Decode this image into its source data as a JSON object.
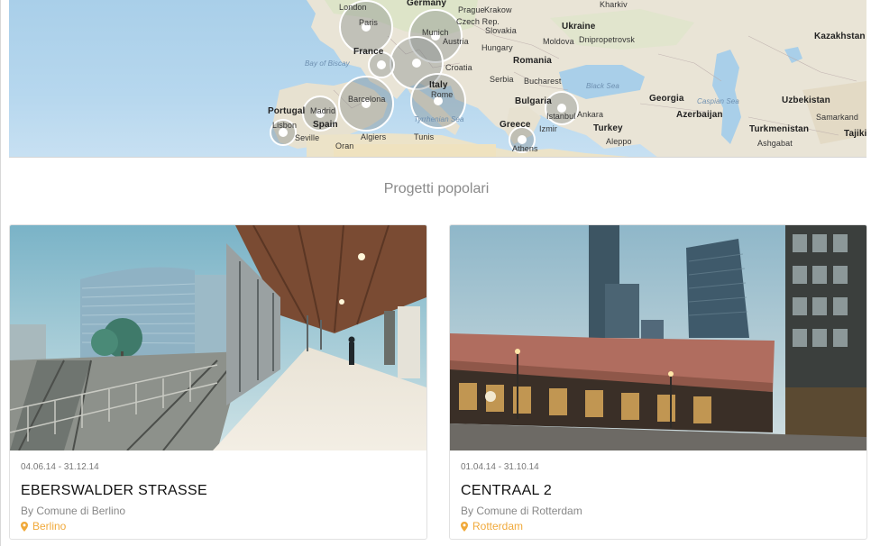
{
  "map": {
    "labels": [
      {
        "text": "London",
        "kind": "normal"
      },
      {
        "text": "Germany",
        "kind": "big"
      },
      {
        "text": "Prague",
        "kind": "normal"
      },
      {
        "text": "Krakow",
        "kind": "normal"
      },
      {
        "text": "Paris",
        "kind": "normal"
      },
      {
        "text": "Czech Rep.",
        "kind": "normal"
      },
      {
        "text": "Slovakia",
        "kind": "normal"
      },
      {
        "text": "Munich",
        "kind": "normal"
      },
      {
        "text": "Austria",
        "kind": "normal"
      },
      {
        "text": "Hungary",
        "kind": "normal"
      },
      {
        "text": "France",
        "kind": "big"
      },
      {
        "text": "Croatia",
        "kind": "normal"
      },
      {
        "text": "Romania",
        "kind": "big"
      },
      {
        "text": "Bay of Biscay",
        "kind": "sea"
      },
      {
        "text": "Serbia",
        "kind": "normal"
      },
      {
        "text": "Bucharest",
        "kind": "normal"
      },
      {
        "text": "Italy",
        "kind": "big"
      },
      {
        "text": "Rome",
        "kind": "normal"
      },
      {
        "text": "Portugal",
        "kind": "big"
      },
      {
        "text": "Madrid",
        "kind": "normal"
      },
      {
        "text": "Spain",
        "kind": "big"
      },
      {
        "text": "Barcelona",
        "kind": "normal"
      },
      {
        "text": "Bulgaria",
        "kind": "big"
      },
      {
        "text": "Istanbul",
        "kind": "normal"
      },
      {
        "text": "Lisbon",
        "kind": "normal"
      },
      {
        "text": "Seville",
        "kind": "normal"
      },
      {
        "text": "Algiers",
        "kind": "normal"
      },
      {
        "text": "Tunis",
        "kind": "normal"
      },
      {
        "text": "Tyrrhenian Sea",
        "kind": "sea"
      },
      {
        "text": "Greece",
        "kind": "big"
      },
      {
        "text": "Izmir",
        "kind": "normal"
      },
      {
        "text": "Turkey",
        "kind": "big"
      },
      {
        "text": "Ukraine",
        "kind": "big"
      },
      {
        "text": "Moldova",
        "kind": "normal"
      },
      {
        "text": "Dnipropetrovsk",
        "kind": "normal"
      },
      {
        "text": "Black Sea",
        "kind": "sea"
      },
      {
        "text": "Georgia",
        "kind": "big"
      },
      {
        "text": "Azerbaijan",
        "kind": "big"
      },
      {
        "text": "Caspian Sea",
        "kind": "sea"
      },
      {
        "text": "Kazakhstan",
        "kind": "big"
      },
      {
        "text": "Uzbekistan",
        "kind": "big"
      },
      {
        "text": "Turkmenistan",
        "kind": "big"
      },
      {
        "text": "Ashgabat",
        "kind": "normal"
      },
      {
        "text": "Samarkand",
        "kind": "normal"
      },
      {
        "text": "Tajiki",
        "kind": "big"
      },
      {
        "text": "Aleppo",
        "kind": "normal"
      },
      {
        "text": "Oran",
        "kind": "normal"
      },
      {
        "text": "Athens",
        "kind": "normal"
      },
      {
        "text": "Ankara",
        "kind": "normal"
      },
      {
        "text": "Kharkiv",
        "kind": "normal"
      }
    ]
  },
  "section_title": "Progetti popolari",
  "cards": [
    {
      "dates": "04.06.14 - 31.12.14",
      "title": "EBERSWALDER STRASSE",
      "by": "By Comune di Berlino",
      "location": "Berlino"
    },
    {
      "dates": "01.04.14 - 31.10.14",
      "title": "CENTRAAL 2",
      "by": "By Comune di Rotterdam",
      "location": "Rotterdam"
    }
  ],
  "colors": {
    "accent_location": "#f0a93a",
    "title_gray": "#8a8a8a"
  }
}
